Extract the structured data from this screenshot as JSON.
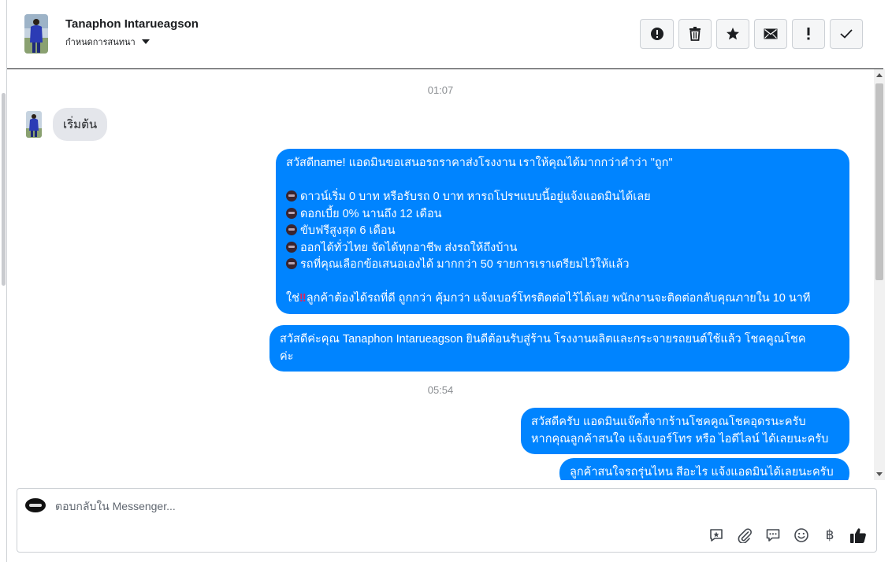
{
  "header": {
    "name": "Tanaphon Intarueagson",
    "label_action": "กำหนดการสนทนา"
  },
  "toolbar": [
    {
      "icon": "alert-circle-icon",
      "label": "Spam"
    },
    {
      "icon": "trash-icon",
      "label": "Delete"
    },
    {
      "icon": "star-icon",
      "label": "Star"
    },
    {
      "icon": "envelope-icon",
      "label": "Mark unread"
    },
    {
      "icon": "exclamation-icon",
      "label": "Follow up"
    },
    {
      "icon": "check-icon",
      "label": "Done"
    }
  ],
  "messages": {
    "time1": "01:07",
    "incoming1": "เริ่มต้น",
    "out1": {
      "line1": "สวัสดีname! แอดมินขอเสนอรถราคาส่งโรงงาน เราให้คุณได้มากกว่าคำว่า \"ถูก\"",
      "bullet1": "ดาวน์เริ่ม 0 บาท หรือรับรถ 0 บาท หารถโปรฯแบบนี้อยู่แจ้งแอดมินได้เลย",
      "bullet2": "ดอกเบี้ย 0% นานถึง 12 เดือน",
      "bullet3": "ขับฟรีสูงสุด 6 เดือน",
      "bullet4": "ออกได้ทั่วไทย จัดได้ทุกอาชีพ ส่งรถให้ถึงบ้าน",
      "bullet5": "รถที่คุณเลือกข้อเสนอเองได้ มากกว่า 50 รายการเราเตรียมไว้ให้แล้ว",
      "closing_prefix": "ใช่",
      "closing_emoji": "‼",
      "closing_rest": "ลูกค้าต้องได้รถที่ดี ถูกกว่า คุ้มกว่า แจ้งเบอร์โทรติดต่อไว้ได้เลย พนักงานจะติดต่อกลับคุณภายใน 10 นาที"
    },
    "out2": {
      "line1": "สวัสดีค่ะคุณ Tanaphon Intarueagson ยินดีต้อนรับสู่ร้าน โรงงานผลิตและกระจายรถยนต์ใช้แล้ว โชคคูณโชค",
      "line2": "ค่ะ"
    },
    "time2": "05:54",
    "out3": {
      "line1": "สวัสดีครับ แอดมินแจ๊คกี้จากร้านโชคคูณโชคอุดรนะครับ",
      "line2": "หากคุณลูกค้าสนใจ แจ้งเบอร์โทร หรือ ไอดีไลน์ ได้เลยนะครับ"
    },
    "out4": "ลูกค้าสนใจรถรุ่นไหน สีอะไร แจ้งแอดมินได้เลยนะครับ"
  },
  "composer": {
    "placeholder": "ตอบกลับใน Messenger...",
    "icons": [
      "saved-reply-icon",
      "attachment-icon",
      "chat-bubble-icon",
      "emoji-icon",
      "baht-icon",
      "thumbs-up-icon"
    ],
    "baht_symbol": "฿"
  },
  "colors": {
    "outgoing_bubble": "#0084ff",
    "incoming_bubble": "#e4e6eb",
    "timestamp": "#8a8d91"
  }
}
